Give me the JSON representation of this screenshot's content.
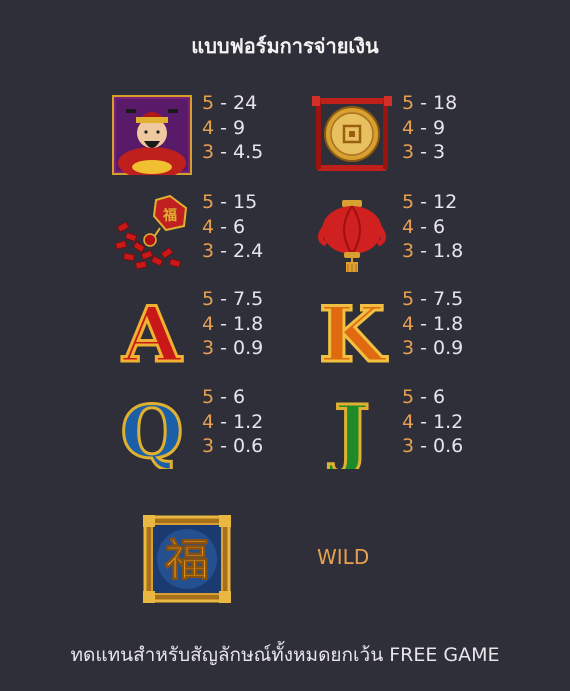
{
  "title": "แบบฟอร์มการจ่ายเงิน",
  "symbols": [
    {
      "icon": "caishen-god-icon",
      "pays": [
        {
          "n": "5",
          "v": " - 24"
        },
        {
          "n": "4",
          "v": " - 9"
        },
        {
          "n": "3",
          "v": " - 4.5"
        }
      ]
    },
    {
      "icon": "gold-coin-gong-icon",
      "pays": [
        {
          "n": "5",
          "v": " - 18"
        },
        {
          "n": "4",
          "v": " - 9"
        },
        {
          "n": "3",
          "v": " - 3"
        }
      ]
    },
    {
      "icon": "firecracker-icon",
      "pays": [
        {
          "n": "5",
          "v": " - 15"
        },
        {
          "n": "4",
          "v": " - 6"
        },
        {
          "n": "3",
          "v": " - 2.4"
        }
      ]
    },
    {
      "icon": "red-lantern-icon",
      "pays": [
        {
          "n": "5",
          "v": " - 12"
        },
        {
          "n": "4",
          "v": " - 6"
        },
        {
          "n": "3",
          "v": " - 1.8"
        }
      ]
    },
    {
      "icon": "letter-a-icon",
      "pays": [
        {
          "n": "5",
          "v": " - 7.5"
        },
        {
          "n": "4",
          "v": " - 1.8"
        },
        {
          "n": "3",
          "v": " - 0.9"
        }
      ]
    },
    {
      "icon": "letter-k-icon",
      "pays": [
        {
          "n": "5",
          "v": " - 7.5"
        },
        {
          "n": "4",
          "v": " - 1.8"
        },
        {
          "n": "3",
          "v": " - 0.9"
        }
      ]
    },
    {
      "icon": "letter-q-icon",
      "pays": [
        {
          "n": "5",
          "v": " - 6"
        },
        {
          "n": "4",
          "v": " - 1.2"
        },
        {
          "n": "3",
          "v": " - 0.6"
        }
      ]
    },
    {
      "icon": "letter-j-icon",
      "pays": [
        {
          "n": "5",
          "v": " - 6"
        },
        {
          "n": "4",
          "v": " - 1.2"
        },
        {
          "n": "3",
          "v": " - 0.6"
        }
      ]
    }
  ],
  "wild": {
    "icon": "fu-wild-icon",
    "label": "WILD",
    "glyph": "福"
  },
  "letters": {
    "a": "A",
    "k": "K",
    "q": "Q",
    "j": "J"
  },
  "footer": "ทดแทนสำหรับสัญลักษณ์ทั้งหมดยกเว้น FREE GAME",
  "colors": {
    "background": "#2f2f3a",
    "accent": "#e8a050",
    "text": "#e6e6ea"
  }
}
